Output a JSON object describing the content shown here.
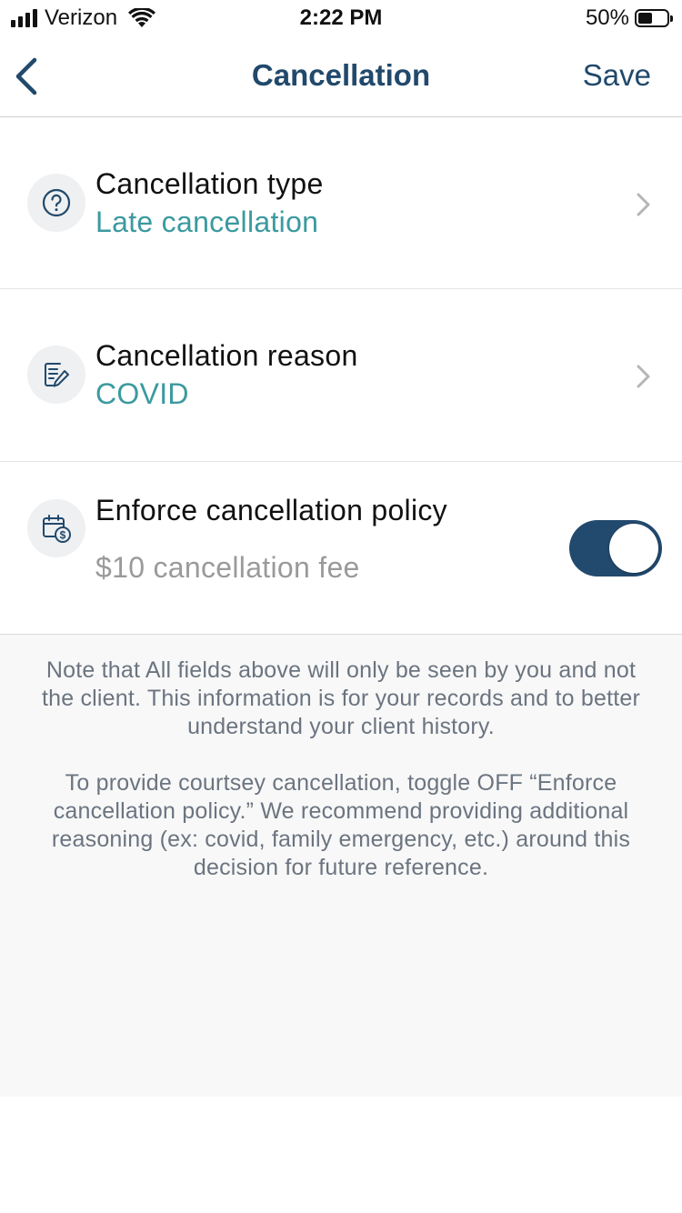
{
  "status_bar": {
    "carrier": "Verizon",
    "time": "2:22 PM",
    "battery_percent": "50%",
    "battery_level": 0.5
  },
  "nav": {
    "title": "Cancellation",
    "save_label": "Save"
  },
  "rows": [
    {
      "label": "Cancellation type",
      "value": "Late cancellation",
      "icon": "question-circle-icon"
    },
    {
      "label": "Cancellation reason",
      "value": "COVID",
      "icon": "notes-edit-icon"
    }
  ],
  "enforce": {
    "label": "Enforce cancellation policy",
    "fee": "$10 cancellation fee",
    "icon": "calendar-dollar-icon",
    "enabled": true
  },
  "note": {
    "paragraph1": "Note that All fields above will only be seen by you and not the client. This information is for your records and to better understand your client history.",
    "paragraph2": "To provide courtsey cancellation, toggle OFF “Enforce cancellation policy.” We recommend providing additional reasoning (ex: covid, family emergency, etc.) around this decision for future reference."
  },
  "colors": {
    "primary": "#21496b",
    "accent_teal": "#3b9a9f",
    "toggle_on": "#224a6e",
    "note_bg": "#f8f8f8"
  }
}
